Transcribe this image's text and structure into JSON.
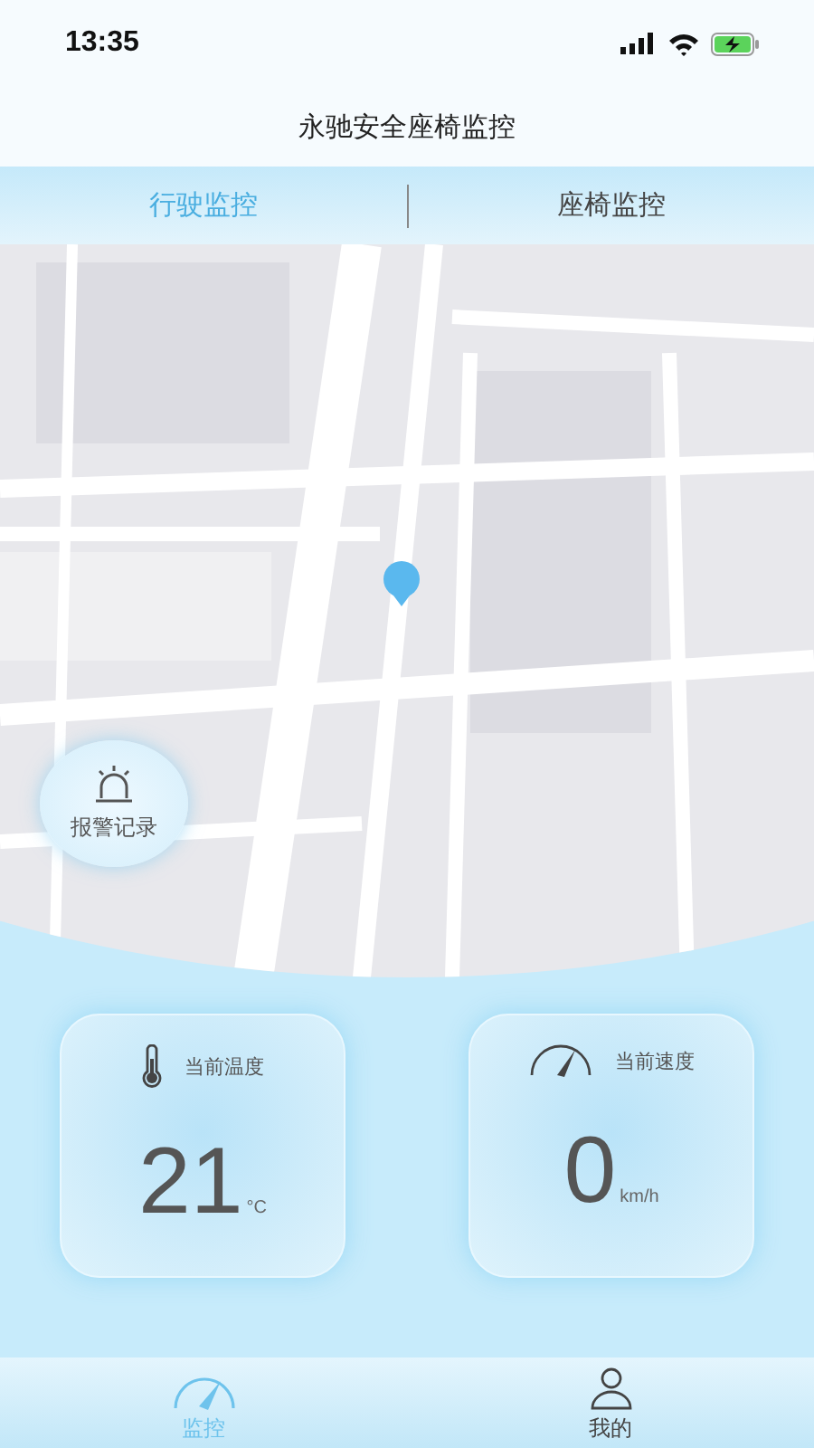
{
  "status_bar": {
    "time": "13:35"
  },
  "title": "永驰安全座椅监控",
  "tabs": [
    {
      "label": "行驶监控",
      "selected": true
    },
    {
      "label": "座椅监控",
      "selected": false
    }
  ],
  "map": {
    "alarm_button": "报警记录"
  },
  "cards": [
    {
      "kind": "temperature",
      "label": "当前温度",
      "value": "21",
      "unit": "°C"
    },
    {
      "kind": "speed",
      "label": "当前速度",
      "value": "0",
      "unit": "km/h"
    }
  ],
  "nav": [
    {
      "kind": "monitor",
      "label": "监控",
      "selected": true
    },
    {
      "kind": "profile",
      "label": "我的",
      "selected": false
    }
  ]
}
